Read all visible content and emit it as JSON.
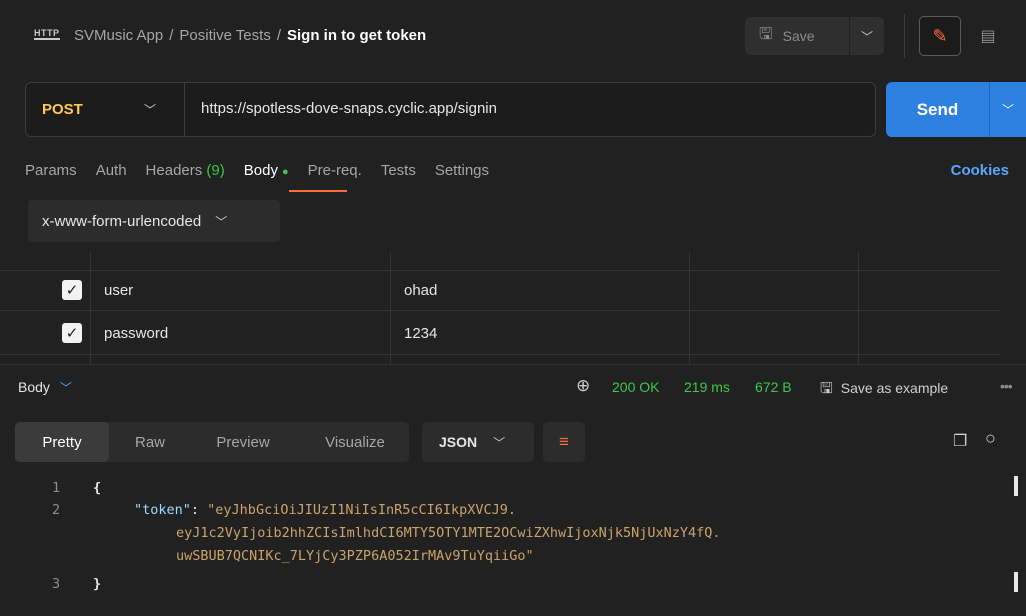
{
  "header": {
    "breadcrumb": [
      "SVMusic App",
      "Positive Tests"
    ],
    "separator": "/",
    "title": "Sign in to get token",
    "save_label": "Save"
  },
  "request": {
    "method": "POST",
    "url": "https://spotless-dove-snaps.cyclic.app/signin",
    "send_label": "Send"
  },
  "tabs": {
    "params": "Params",
    "auth": "Auth",
    "headers": "Headers",
    "headers_count": "(9)",
    "body": "Body",
    "prereq": "Pre-req.",
    "tests": "Tests",
    "settings": "Settings",
    "cookies": "Cookies"
  },
  "body_type": "x-www-form-urlencoded",
  "params": [
    {
      "checked": true,
      "key": "user",
      "value": "ohad"
    },
    {
      "checked": true,
      "key": "password",
      "value": "1234"
    }
  ],
  "response": {
    "label": "Body",
    "status": "200 OK",
    "time": "219 ms",
    "size": "672 B",
    "save_example": "Save as example",
    "more": "•••",
    "view_tabs": [
      "Pretty",
      "Raw",
      "Preview",
      "Visualize"
    ],
    "format": "JSON",
    "code": {
      "line_numbers": [
        "1",
        "2",
        "3"
      ],
      "open_brace": "{",
      "close_brace": "}",
      "key": "\"token\"",
      "colon": ": ",
      "value_lines": [
        "\"eyJhbGciOiJIUzI1NiIsInR5cCI6IkpXVCJ9.",
        "eyJ1c2VyIjoib2hhZCIsImlhdCI6MTY5OTY1MTE2OCwiZXhwIjoxNjk5NjUxNzY4fQ.",
        "uwSBUB7QCNIKc_7LYjCy3PZP6A052IrMAv9TuYqiiGo\""
      ]
    }
  },
  "colors": {
    "accent": "#ff6c37",
    "send": "#2d7fe0",
    "success": "#3ec74a",
    "method": "#ffc857"
  }
}
